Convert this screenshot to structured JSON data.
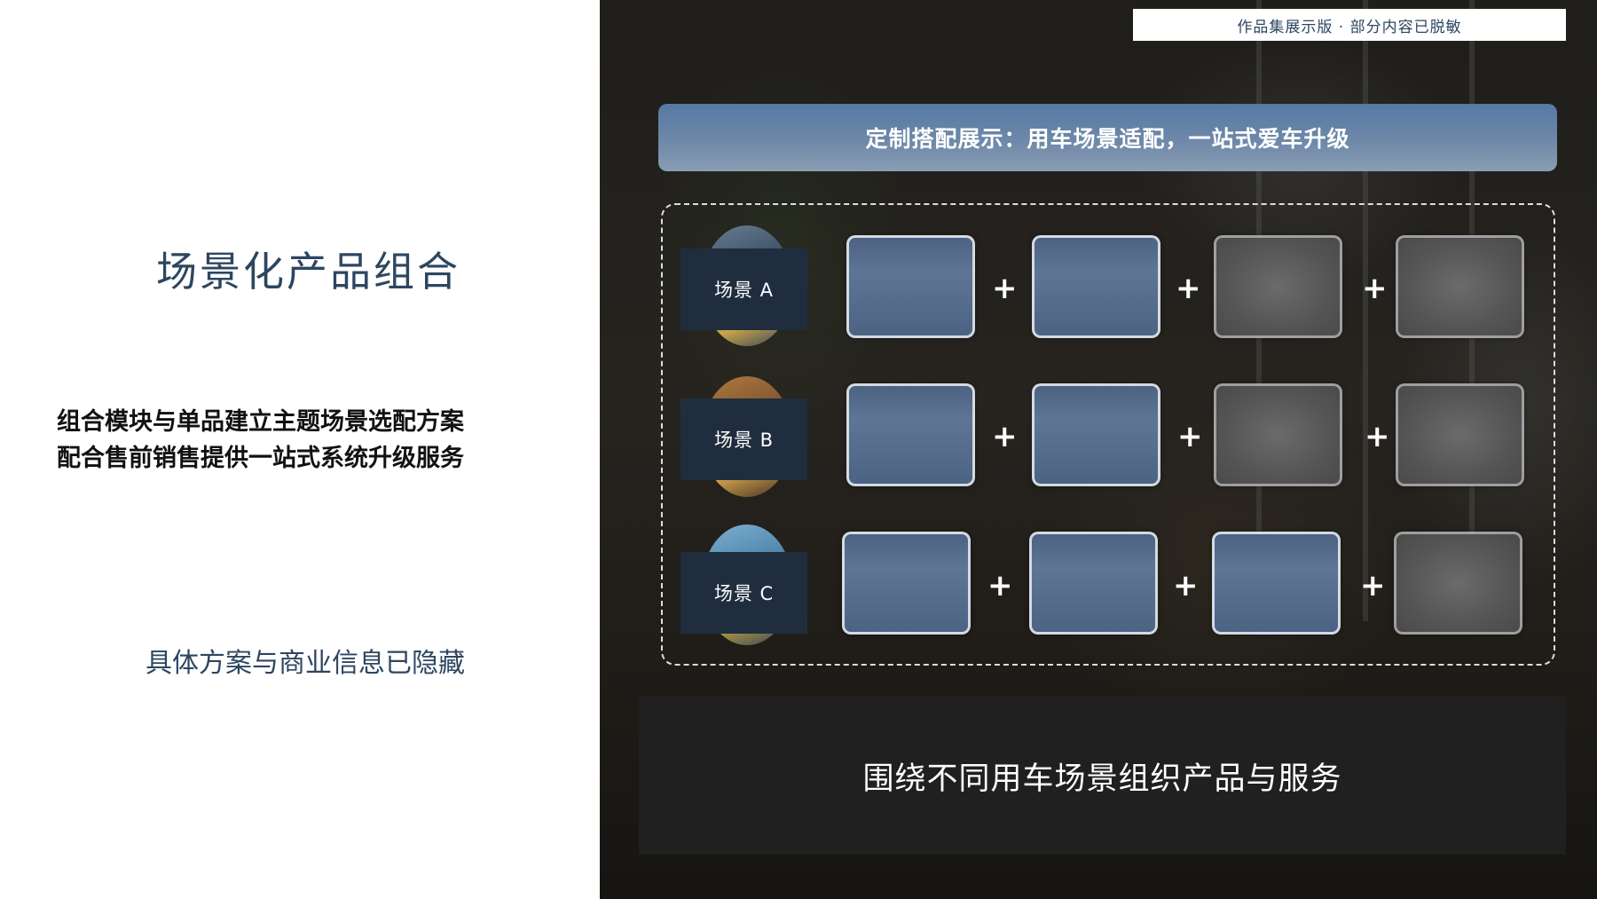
{
  "left": {
    "title": "场景化产品组合",
    "desc_line1": "组合模块与单品建立主题场景选配方案",
    "desc_line2": "配合售前销售提供一站式系统升级服务",
    "note": "具体方案与商业信息已隐藏"
  },
  "right": {
    "watermark": "作品集展示版 ·   部分内容已脱敏",
    "banner": "定制搭配展示：用车场景适配，一站式爱车升级",
    "scenes": [
      {
        "label": "场景 A",
        "card_tones": [
          "blue",
          "blue",
          "gray",
          "gray"
        ]
      },
      {
        "label": "场景 B",
        "card_tones": [
          "blue",
          "blue",
          "gray",
          "gray"
        ]
      },
      {
        "label": "场景 C",
        "card_tones": [
          "blue",
          "blue",
          "blue",
          "gray"
        ]
      }
    ],
    "plus_symbol": "+",
    "bottom_text": "围绕不同用车场景组织产品与服务"
  },
  "colors": {
    "title_color": "#2d4660",
    "banner_start": "#5579a5",
    "scene_box": "#1f2d3e",
    "bottom_box": "#202020"
  }
}
